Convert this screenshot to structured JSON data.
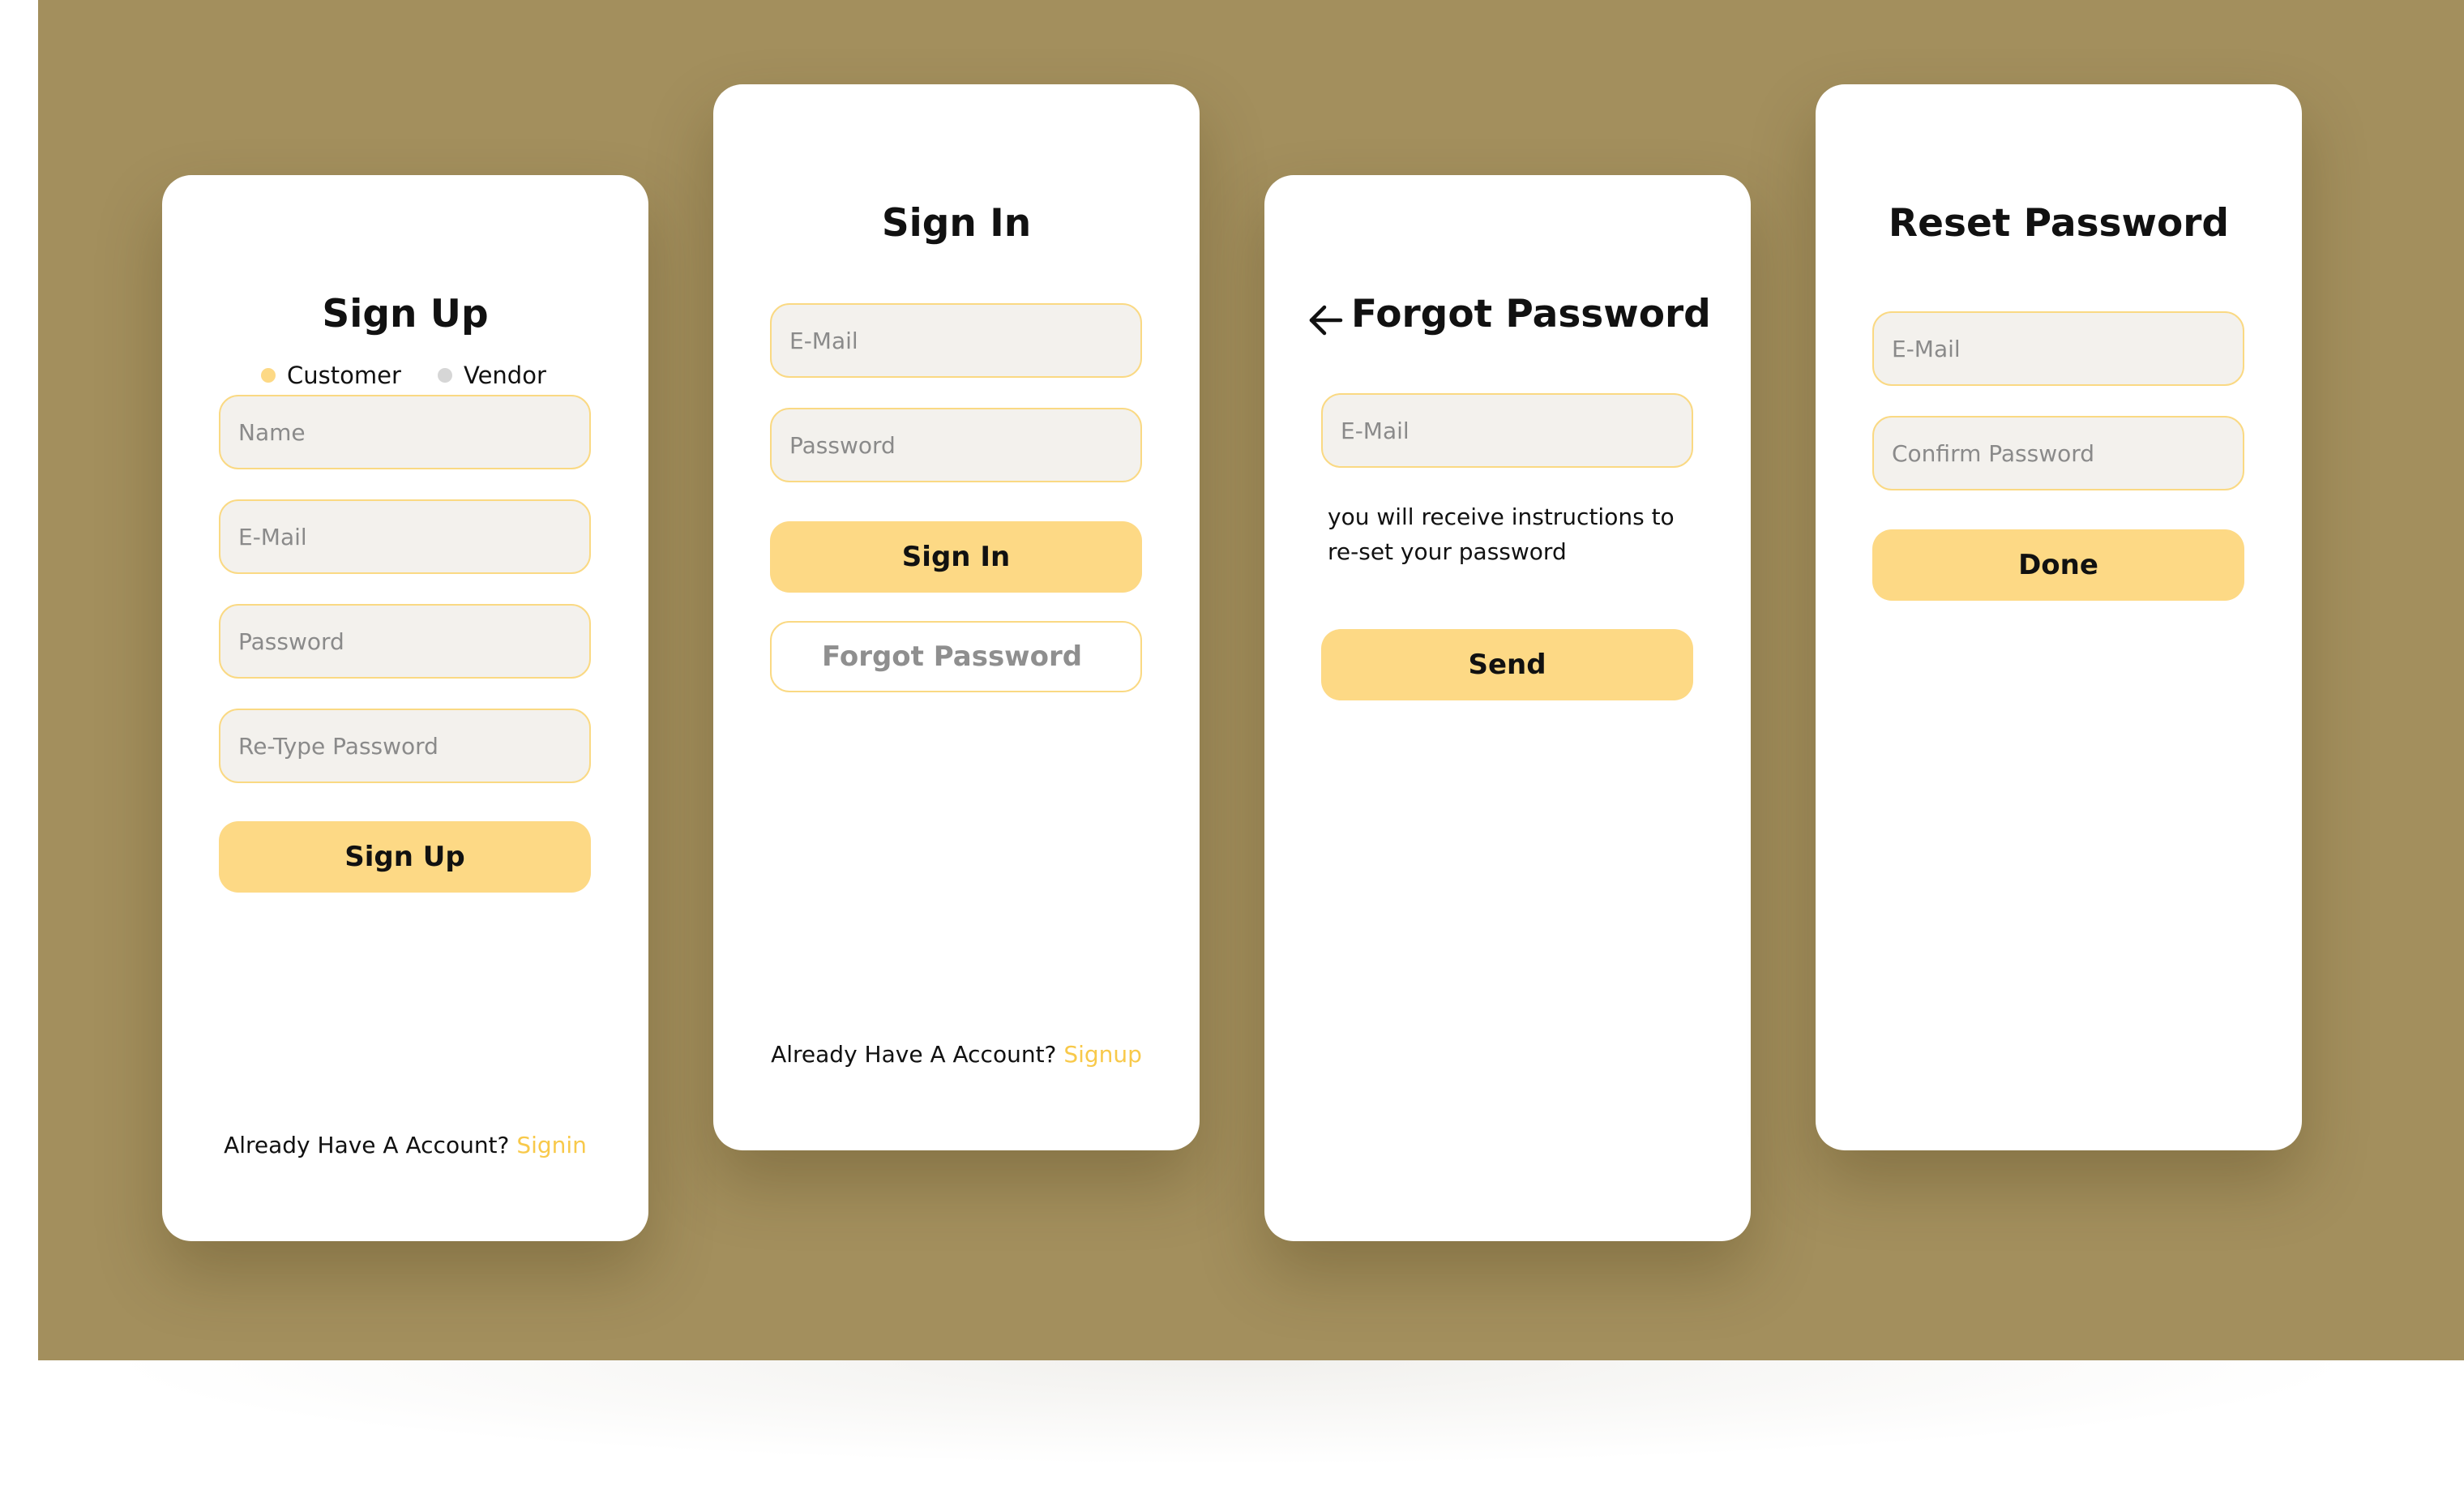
{
  "colors": {
    "background": "#a38f5d",
    "accent": "#fdd985",
    "field_border": "#fad983",
    "link": "#f8c94a",
    "radio_selected": "#fdd985",
    "radio_unselected": "#d6d6d6"
  },
  "signup": {
    "title": "Sign Up",
    "account_type": {
      "selected": "Customer",
      "options": [
        "Customer",
        "Vendor"
      ]
    },
    "fields": {
      "name_placeholder": "Name",
      "email_placeholder": "E-Mail",
      "password_placeholder": "Password",
      "retype_placeholder": "Re-Type Password"
    },
    "submit_label": "Sign Up",
    "footer_text": "Already Have A Account? ",
    "footer_link": "Signin"
  },
  "signin": {
    "title": "Sign In",
    "fields": {
      "email_placeholder": "E-Mail",
      "password_placeholder": "Password"
    },
    "submit_label": "Sign In",
    "forgot_label": "Forgot Password",
    "footer_text": "Already Have A Account? ",
    "footer_link": "Signup"
  },
  "forgot": {
    "title": "Forgot Password",
    "back_icon": "arrow-left-icon",
    "fields": {
      "email_placeholder": "E-Mail"
    },
    "helper_text": "you will receive instructions to re-set your password",
    "submit_label": "Send"
  },
  "reset": {
    "title": "Reset Password",
    "fields": {
      "email_placeholder": "E-Mail",
      "confirm_placeholder": "Confirm Password"
    },
    "submit_label": "Done"
  }
}
